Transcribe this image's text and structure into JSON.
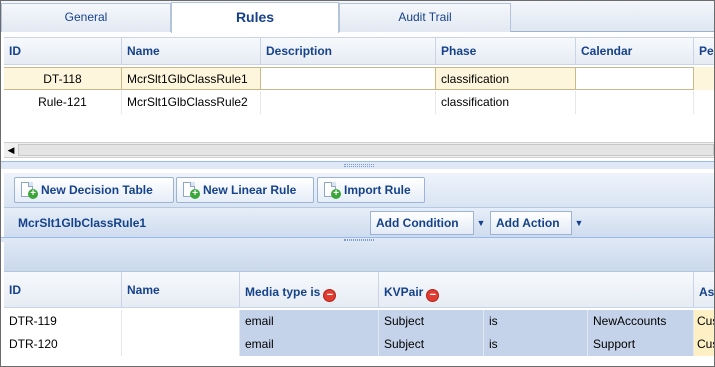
{
  "tabs": [
    {
      "label": "General"
    },
    {
      "label": "Rules"
    },
    {
      "label": "Audit Trail"
    }
  ],
  "rules_grid": {
    "columns": [
      "ID",
      "Name",
      "Description",
      "Phase",
      "Calendar",
      "Pe"
    ],
    "rows": [
      {
        "id": "DT-118",
        "name": "McrSlt1GlbClassRule1",
        "description": "",
        "phase": "classification",
        "calendar": ""
      },
      {
        "id": "Rule-121",
        "name": "McrSlt1GlbClassRule2",
        "description": "",
        "phase": "classification",
        "calendar": ""
      }
    ]
  },
  "toolbar": {
    "new_decision_table": "New Decision Table",
    "new_linear_rule": "New Linear Rule",
    "import_rule": "Import Rule"
  },
  "rule_editor": {
    "title": "McrSlt1GlbClassRule1",
    "add_condition": "Add Condition",
    "add_action": "Add Action"
  },
  "decision_grid": {
    "columns": [
      "ID",
      "Name",
      "Media type is",
      "KVPair",
      "As"
    ],
    "rows": [
      {
        "id": "DTR-119",
        "name": "",
        "media": "email",
        "key": "Subject",
        "op": "is",
        "value": "NewAccounts",
        "extra": "Cus"
      },
      {
        "id": "DTR-120",
        "name": "",
        "media": "email",
        "key": "Subject",
        "op": "is",
        "value": "Support",
        "extra": "Cus"
      }
    ]
  }
}
